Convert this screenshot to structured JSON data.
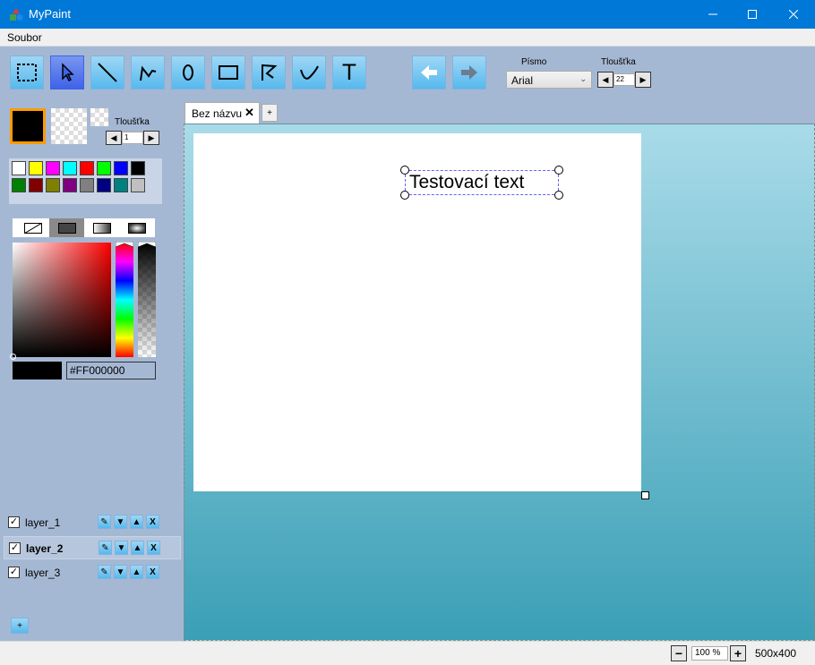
{
  "window": {
    "title": "MyPaint"
  },
  "menu": {
    "file": "Soubor"
  },
  "toolbar": {
    "tools": [
      {
        "name": "select-rect",
        "icon": "dashed-rectangle-icon",
        "active": false
      },
      {
        "name": "pointer",
        "icon": "cursor-arrow-icon",
        "active": true
      },
      {
        "name": "line",
        "icon": "line-icon",
        "active": false
      },
      {
        "name": "polyline",
        "icon": "polyline-icon",
        "active": false
      },
      {
        "name": "ellipse",
        "icon": "ellipse-icon",
        "active": false
      },
      {
        "name": "rectangle",
        "icon": "rectangle-icon",
        "active": false
      },
      {
        "name": "polygon",
        "icon": "polygon-icon",
        "active": false
      },
      {
        "name": "curve",
        "icon": "curve-icon",
        "active": false
      },
      {
        "name": "text",
        "icon": "text-icon",
        "active": false
      }
    ],
    "text_tool_glyph": "T",
    "undo_icon": "arrow-left-icon",
    "redo_icon": "arrow-right-icon",
    "font_label": "Písmo",
    "font_value": "Arial",
    "stroke_label": "Tloušťka",
    "stroke_value": "22"
  },
  "colors": {
    "primary": "#000000",
    "accent_border": "#ff9a00",
    "brush_label": "Tloušťka",
    "brush_value": "1",
    "palette": [
      "#ffffff",
      "#ffff00",
      "#ff00ff",
      "#00ffff",
      "#ff0000",
      "#00ff00",
      "#0000ff",
      "#000000",
      "#008000",
      "#800000",
      "#808000",
      "#800080",
      "#808080",
      "#000080",
      "#008080",
      "#c0c0c0"
    ],
    "hex_value": "#FF000000"
  },
  "layers": [
    {
      "name": "layer_1",
      "checked": true,
      "selected": false
    },
    {
      "name": "layer_2",
      "checked": true,
      "selected": true
    },
    {
      "name": "layer_3",
      "checked": true,
      "selected": false
    }
  ],
  "layer_add": "+",
  "document": {
    "tab_title": "Bez názvu",
    "tab_close": "✕",
    "new_tab": "+",
    "text_object": "Testovací text"
  },
  "status": {
    "zoom_minus": "−",
    "zoom_value": "100 %",
    "zoom_plus": "+",
    "canvas_size": "500x400"
  }
}
